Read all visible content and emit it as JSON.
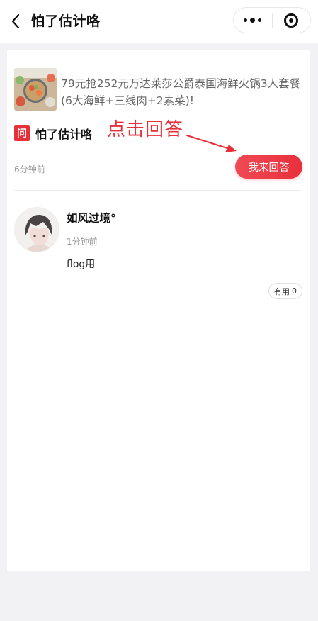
{
  "nav": {
    "title": "怕了估计咯"
  },
  "product": {
    "title": "79元抢252元万达莱莎公爵泰国海鲜火锅3人套餐 (6大海鲜+三线肉+2素菜)!"
  },
  "question": {
    "badge": "问",
    "text": "怕了估计咯",
    "time": "6分钟前",
    "answer_button_label": "我来回答"
  },
  "annotation": {
    "text": "点击回答",
    "color": "#e8303b"
  },
  "answer": {
    "user_name": "如风过境°",
    "time": "1分钟前",
    "content": "flog用",
    "useful_label": "有用",
    "useful_count": "0"
  },
  "colors": {
    "accent": "#e8303b",
    "page_bg": "#f2f2f4"
  },
  "icons": {
    "back": "chevron-left-icon",
    "more": "more-dots-icon",
    "close": "target-circle-icon"
  }
}
